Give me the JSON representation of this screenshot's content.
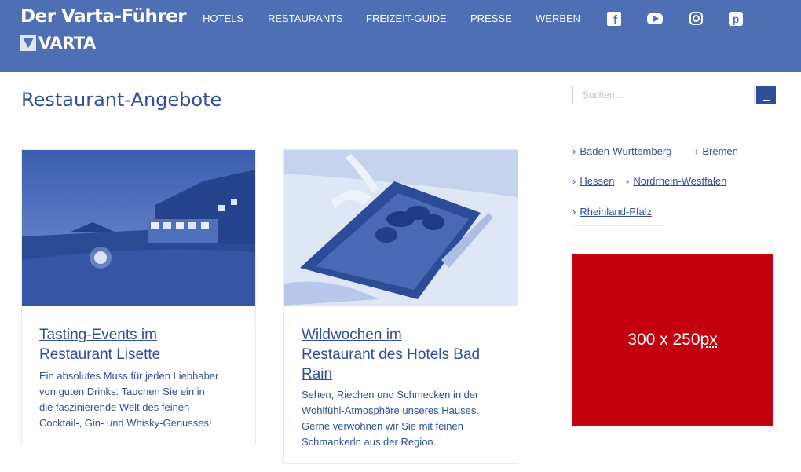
{
  "header": {
    "title": "Der Varta-Führer",
    "logo_text": "VARTA",
    "nav": [
      "HOTELS",
      "RESTAURANTS",
      "FREIZEIT-GUIDE",
      "PRESSE",
      "WERBEN"
    ],
    "social": [
      "facebook-icon",
      "youtube-icon",
      "instagram-icon",
      "pinterest-icon"
    ],
    "fb_glyph": "f",
    "pin_glyph": "p"
  },
  "main": {
    "page_title": "Restaurant-Angebote",
    "cards": [
      {
        "title_line1": "Tasting-Events im",
        "title_line2": "Restaurant Lisette",
        "text_lines": [
          "Ein absolutes Muss für jeden Liebhaber",
          "von guten Drinks: Tauchen Sie ein in",
          "die faszinierende Welt des feinen",
          "Cocktail-, Gin- und Whisky-Genusses!"
        ]
      },
      {
        "title_line1": "Wildwochen im",
        "title_line2": "Restaurant des Hotels Bad",
        "title_line3": "Rain",
        "text_lines": [
          "Sehen, Riechen und Schmecken in der",
          "Wohlfühl-Atmosphäre unseres Hauses.",
          "Gerne verwöhnen wir Sie mit feinen",
          "Schmankerln aus der Region."
        ]
      }
    ]
  },
  "sidebar": {
    "search_placeholder": "Suchen ...",
    "categories": [
      "Baden-Württemberg",
      "Bremen",
      "Hessen",
      "Nordrhein-Westfalen",
      "Rheinland-Pfalz"
    ],
    "chevron": "›",
    "ad_text": "300 x 250 ",
    "ad_unit": "px"
  },
  "colors": {
    "header_bg": "#4f6fb4",
    "text": "#2f4f98",
    "ad_bg": "#c3000e"
  }
}
